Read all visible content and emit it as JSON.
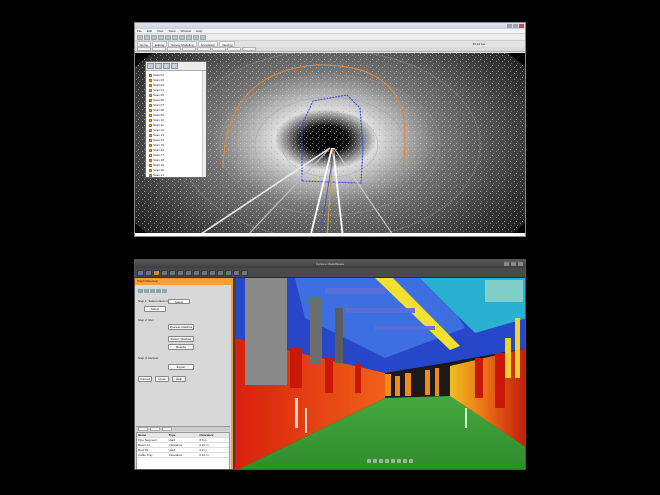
{
  "top_window": {
    "menu": [
      "File",
      "Edit",
      "View",
      "Tools",
      "Window",
      "Help"
    ],
    "tabs": [
      "Home",
      "Editing",
      "Survey Modeling",
      "Annotation",
      "Viewing"
    ],
    "status": "25.12 fps",
    "tree_items": [
      "Scan 01",
      "Scan 02",
      "Scan 03",
      "Scan 04",
      "Scan 05",
      "Scan 06",
      "Scan 07",
      "Scan 08",
      "Scan 09",
      "Scan 10",
      "Scan 11",
      "Scan 12",
      "Scan 13",
      "Scan 14",
      "Scan 15",
      "Scan 16",
      "Scan 17",
      "Scan 18",
      "Scan 19",
      "Scan 20",
      "Scan 21"
    ]
  },
  "bottom_window": {
    "title": "Cyclone ModelSpace",
    "panel_title": "Clash Detection",
    "panel_rows": [
      "Step 1: Select clash criteria",
      "Step 2: Run",
      "Step 3: Review"
    ],
    "buttons": {
      "select": "Select",
      "process": "Process Clashes",
      "detect": "Detect Clashes",
      "results": "Results",
      "export": "Export",
      "cancel": "Cancel",
      "close": "Close",
      "help": "Help"
    },
    "select_box": "Select",
    "table": {
      "headers": [
        "Name",
        "Type",
        "Clearance"
      ],
      "rows": [
        [
          "Pipe Segment",
          "Hard",
          "0.0 m"
        ],
        [
          "Beam 01",
          "Clearance",
          "0.15 m"
        ],
        [
          "Duct 03",
          "Hard",
          "0.0 m"
        ],
        [
          "Cable Tray",
          "Clearance",
          "0.10 m"
        ]
      ]
    }
  },
  "colors": {
    "panel_accent": "#ff9a3a",
    "clash_red": "#e02a10",
    "clear_green": "#3fa83a",
    "near_blue": "#2a4fd0",
    "warn_yellow": "#f3e030"
  }
}
